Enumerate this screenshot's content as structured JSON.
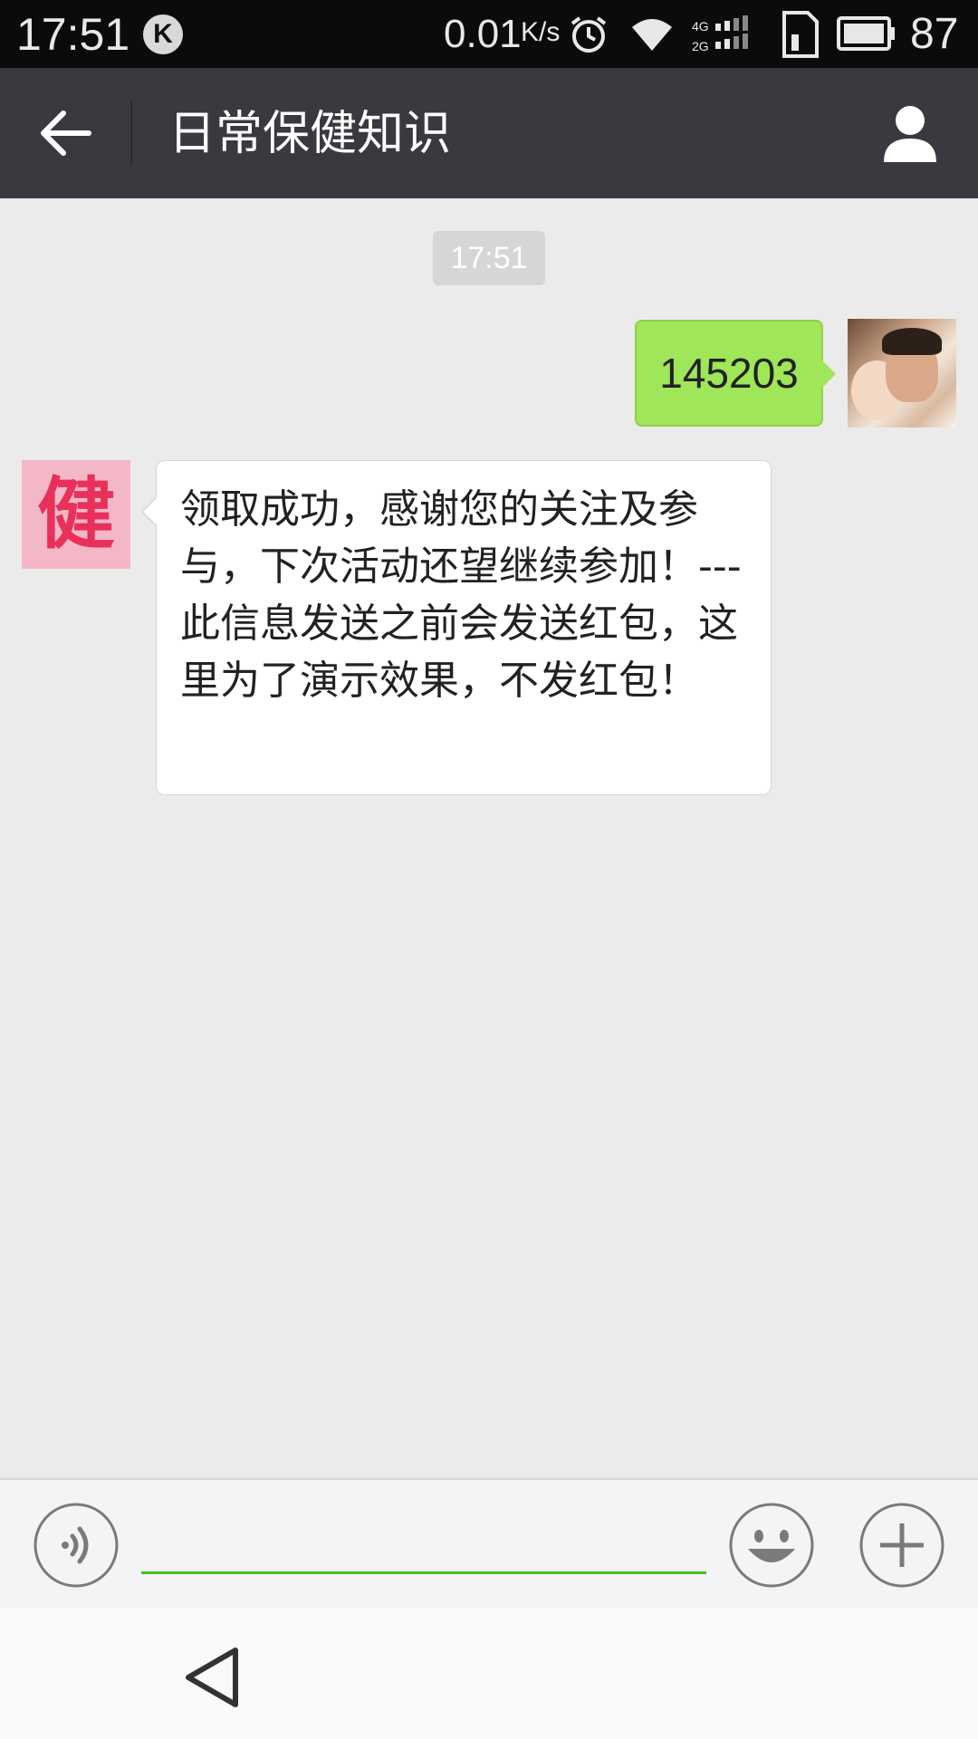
{
  "status_bar": {
    "time": "17:51",
    "k_label": "K",
    "net_speed": "0.01",
    "net_speed_unit": "K/s",
    "battery_percent": "87"
  },
  "header": {
    "title": "日常保健知识"
  },
  "chat": {
    "timestamp": "17:51",
    "messages": [
      {
        "sender": "me",
        "text": "145203"
      },
      {
        "sender": "bot",
        "avatar_text": "健",
        "text": "领取成功，感谢您的关注及参与，下次活动还望继续参加！---此信息发送之前会发送红包，这里为了演示效果，不发红包！"
      }
    ]
  },
  "input": {
    "value": "",
    "placeholder": ""
  },
  "icons": {
    "back": "arrow-left-icon",
    "profile": "user-icon",
    "voice": "voice-icon",
    "emoji": "smiley-icon",
    "more": "plus-icon",
    "nav_back": "triangle-back-icon"
  },
  "colors": {
    "header_bg": "#393a3f",
    "chat_bg": "#ebebeb",
    "outgoing_bubble": "#9fe658",
    "incoming_bubble": "#ffffff",
    "input_underline": "#45c01a",
    "bot_avatar_bg": "#f4b7c7",
    "bot_avatar_text": "#e8305a"
  }
}
